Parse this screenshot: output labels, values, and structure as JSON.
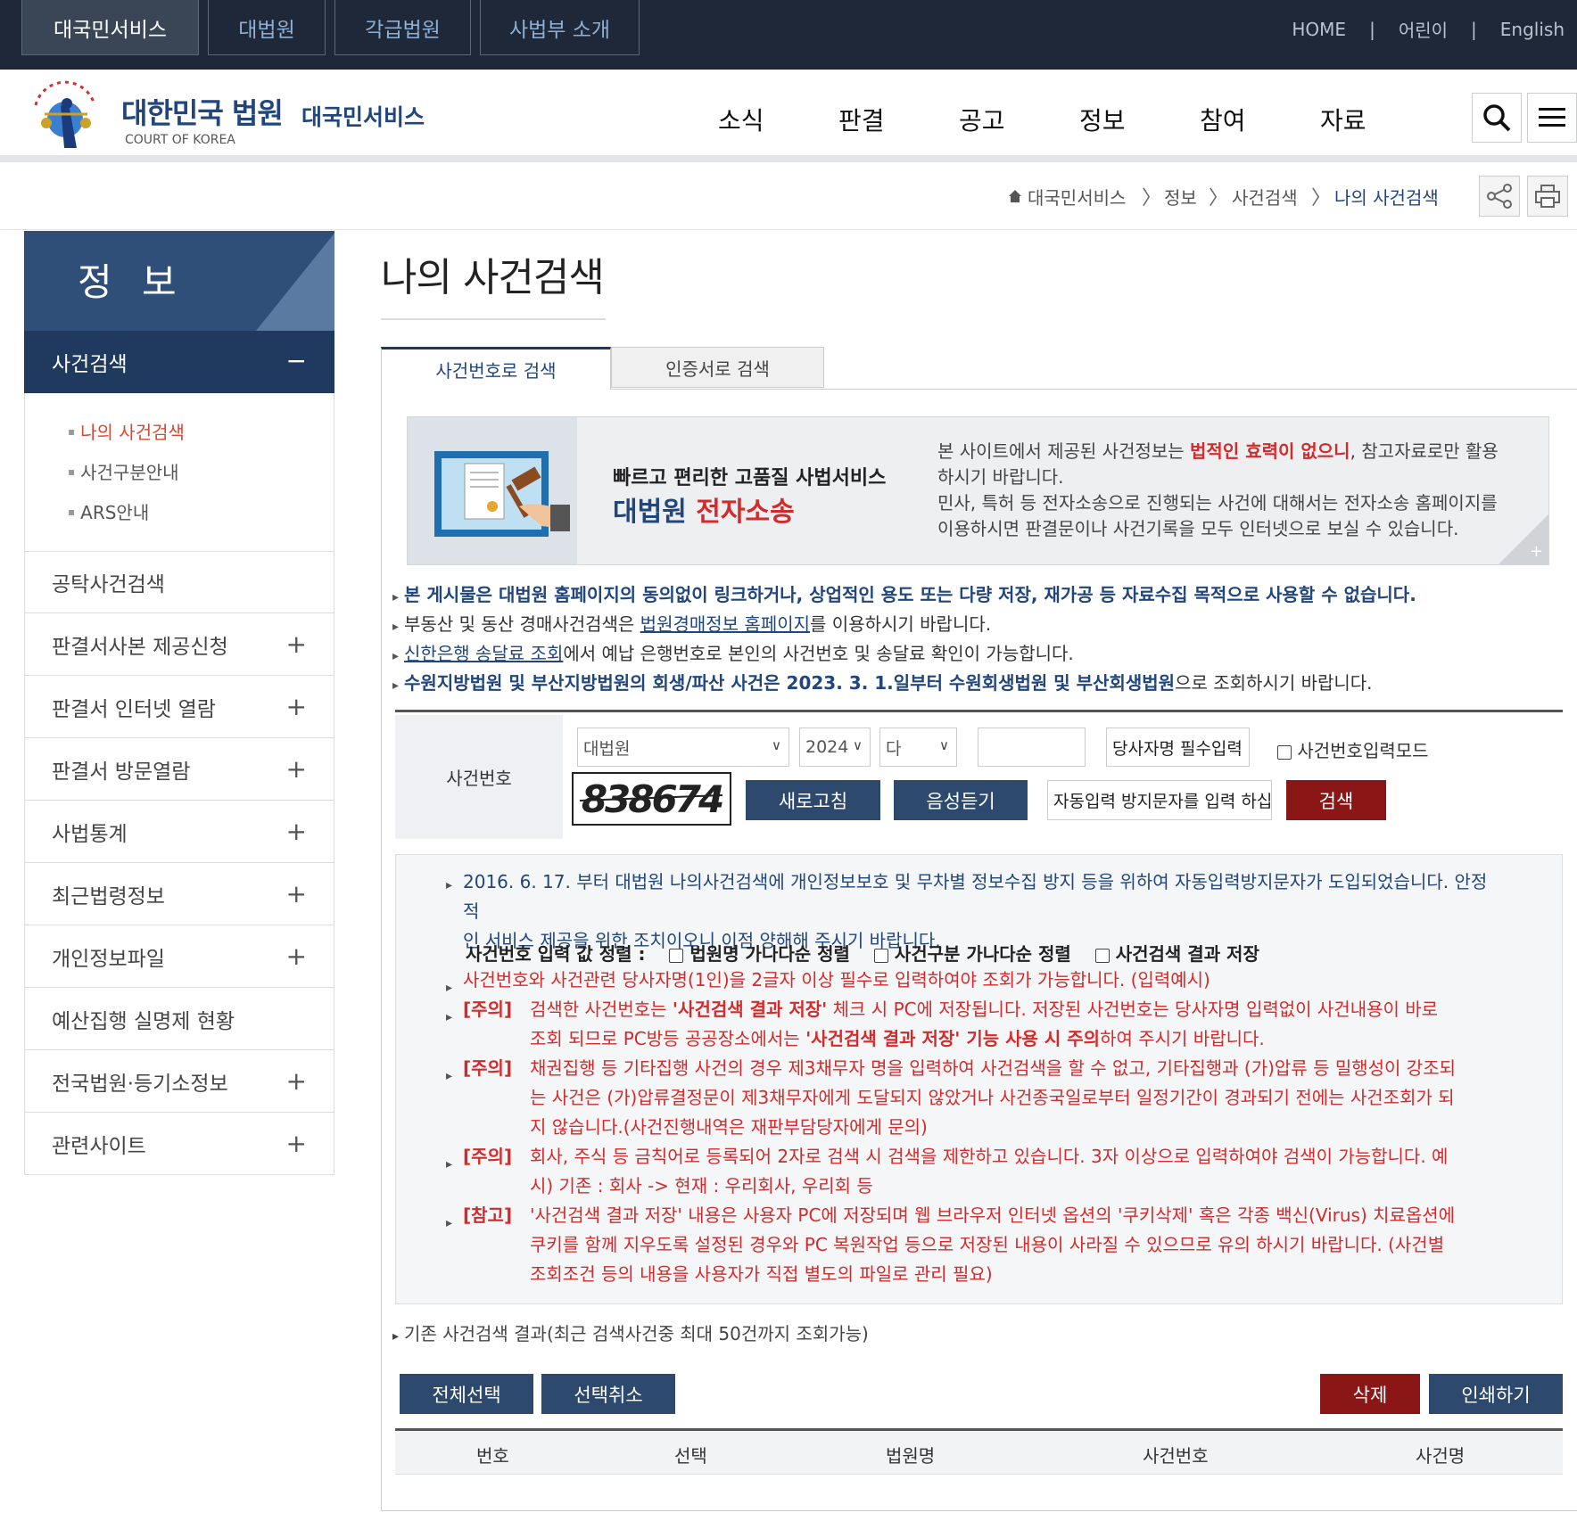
{
  "topbar": {
    "tabs": [
      "대국민서비스",
      "대법원",
      "각급법원",
      "사법부 소개"
    ],
    "links": [
      "HOME",
      "어린이",
      "English"
    ]
  },
  "header": {
    "logo_title": "대한민국 법원",
    "logo_sub": "COURT OF KOREA",
    "logo_service": "대국민서비스",
    "nav": [
      "소식",
      "판결",
      "공고",
      "정보",
      "참여",
      "자료"
    ]
  },
  "breadcrumb": [
    "대국민서비스",
    "정보",
    "사건검색",
    "나의 사건검색"
  ],
  "sidebar": {
    "title": "정 보",
    "active": "사건검색",
    "active_toggle": "−",
    "sub_items": [
      "나의 사건검색",
      "사건구분안내",
      "ARS안내"
    ],
    "items": [
      {
        "label": "공탁사건검색",
        "toggle": ""
      },
      {
        "label": "판결서사본 제공신청",
        "toggle": "+"
      },
      {
        "label": "판결서 인터넷 열람",
        "toggle": "+"
      },
      {
        "label": "판결서 방문열람",
        "toggle": "+"
      },
      {
        "label": "사법통계",
        "toggle": "+"
      },
      {
        "label": "최근법령정보",
        "toggle": "+"
      },
      {
        "label": "개인정보파일",
        "toggle": "+"
      },
      {
        "label": "예산집행 실명제 현황",
        "toggle": ""
      },
      {
        "label": "전국법원·등기소정보",
        "toggle": "+"
      },
      {
        "label": "관련사이트",
        "toggle": "+"
      }
    ]
  },
  "page_title": "나의 사건검색",
  "tabs": [
    "사건번호로 검색",
    "인증서로 검색"
  ],
  "banner": {
    "line1": "빠르고 편리한 고품질 사법서비스",
    "line2a": "대법원",
    "line2b": "전자소송",
    "text1": "본 사이트에서 제공된 사건정보는 ",
    "text_red": "법적인 효력이 없으니",
    "text2": ", 참고자료로만 활용하시기 바랍니다.",
    "text3": "민사, 특허 등 전자소송으로 진행되는 사건에 대해서는 전자소송 홈페이지를 이용하시면 판결문이나 사건기록을 모두 인터넷으로 보실 수 있습니다.",
    "plus": "+"
  },
  "notices": {
    "n1": "본 게시물은 대법원 홈페이지의 동의없이 링크하거나, 상업적인 용도 또는 다량 저장, 재가공 등 자료수집 목적으로 사용할 수 없습니다.",
    "n2a": "부동산 및 동산 경매사건검색은 ",
    "n2link": "법원경매정보 홈페이지",
    "n2b": "를 이용하시기 바랍니다.",
    "n3link": "신한은행 송달료 조회",
    "n3b": "에서 예납 은행번호로 본인의 사건번호 및 송달료 확인이 가능합니다.",
    "n4a": "수원지방법원 및 부산지방법원의 회생/파산 사건은 2023. 3. 1.일부터 수원회생법원 및 부산회생법원",
    "n4b": "으로 조회하시기 바랍니다."
  },
  "search": {
    "label": "사건번호",
    "court": "대법원",
    "year": "2024",
    "type": "다",
    "case_number": "",
    "party_placeholder": "당사자명 필수입력",
    "mode_label": "사건번호입력모드",
    "captcha_text": "838674",
    "refresh": "새로고침",
    "listen": "음성듣기",
    "captcha_placeholder": "자동입력 방지문자를 입력 하십",
    "search_button": "검색"
  },
  "info": {
    "line1": "2016. 6. 17. 부터 대법원 나의사건검색에 개인정보보호 및 무차별 정보수집 방지 등을 위하여 자동입력방지문자가 도입되었습니다. 안정적",
    "line1b": "인 서비스 제공을 위한 조치이오니 이점 양해해 주시기 바랍니다.",
    "sort_label": "사건번호 입력 값 정렬 :",
    "sort1": "법원명 가나다순 정렬",
    "sort2": "사건구분 가나다순 정렬",
    "sort3": "사건검색 결과 저장",
    "req": "사건번호와 사건관련 당사자명(1인)을 2글자 이상 필수로 입력하여야 조회가 가능합니다. (입력예시)",
    "c1_tag": "[주의]",
    "c1a": "검색한 사건번호는 ",
    "c1b": "'사건검색 결과 저장'",
    "c1c": " 체크 시 PC에 저장됩니다. 저장된 사건번호는 당사자명 입력없이 사건내용이 바로 조",
    "c1d": "회 되므로 PC방등 공공장소에서는 ",
    "c1e": "'사건검색 결과 저장' 기능 사용 시 주의",
    "c1f": "하여 주시기 바랍니다.",
    "c2_tag": "[주의]",
    "c2": "채권집행 등 기타집행 사건의 경우 제3채무자 명을 입력하여 사건검색을 할 수 없고, 기타집행과 (가)압류 등 밀행성이 강조되는 사건은 (가)압류결정문이 제3채무자에게 도달되지 않았거나 사건종국일로부터 일정기간이 경과되기 전에는 사건조회가 되지 않습니다.(사건진행내역은 재판부담당자에게 문의)",
    "c3_tag": "[주의]",
    "c3": "회사, 주식 등 금칙어로 등록되어 2자로 검색 시 검색을 제한하고 있습니다. 3자 이상으로 입력하여야 검색이 가능합니다. 예시) 기존 : 회사 -> 현재 : 우리회사, 우리회 등",
    "c4_tag": "[참고]",
    "c4": "'사건검색 결과 저장' 내용은 사용자 PC에 저장되며 웹 브라우저 인터넷 옵션의 '쿠키삭제' 혹은 각종 백신(Virus) 치료옵션에 쿠키를 함께 지우도록 설정된 경우와 PC 복원작업 등으로 저장된 내용이 사라질 수 있으므로 유의 하시기 바랍니다. (사건별 조회조건 등의 내용을 사용자가 직접 별도의 파일로 관리 필요)"
  },
  "results": {
    "note": "기존 사건검색 결과(최근 검색사건중 최대 50건까지 조회가능)",
    "select_all": "전체선택",
    "deselect": "선택취소",
    "delete": "삭제",
    "print": "인쇄하기",
    "columns": [
      "번호",
      "선택",
      "법원명",
      "사건번호",
      "사건명"
    ]
  },
  "colors": {
    "navy": "#2d4a6e",
    "dark_red": "#8a1616",
    "accent_red": "#d32b2b",
    "link_blue": "#21467c"
  },
  "icons": [
    "search-icon",
    "menu-icon",
    "home-icon",
    "share-icon",
    "print-icon"
  ]
}
